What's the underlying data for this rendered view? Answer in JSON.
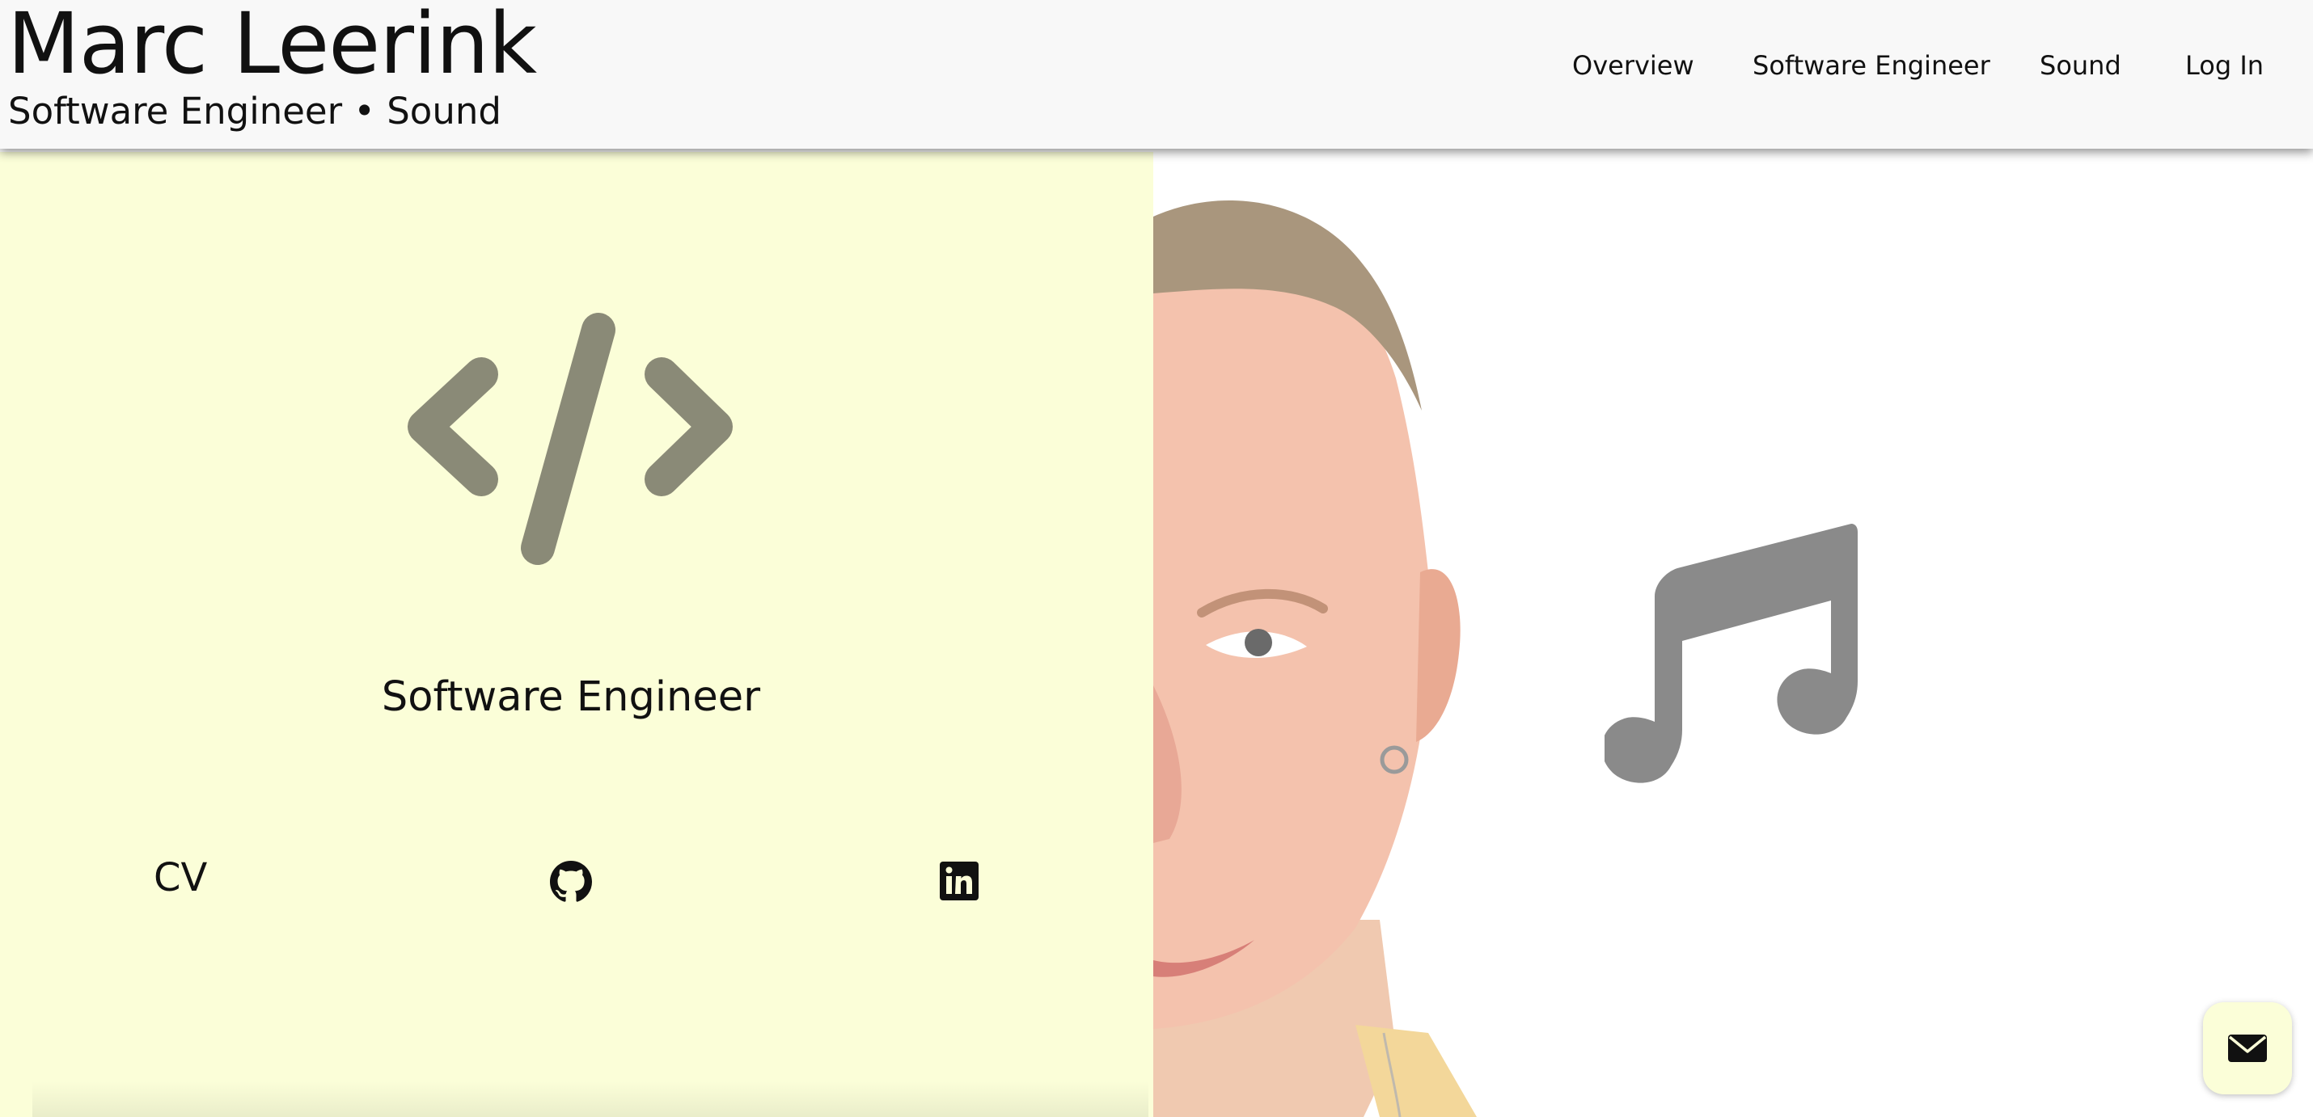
{
  "header": {
    "name": "Marc Leerink",
    "tagline": "Software Engineer • Sound"
  },
  "nav": {
    "items": [
      "Overview",
      "Software Engineer",
      "Sound",
      "Log In"
    ]
  },
  "left_panel": {
    "title": "Software Engineer",
    "icon": "code-icon",
    "links": {
      "cv_label": "CV",
      "github_icon": "github-icon",
      "linkedin_icon": "linkedin-icon"
    }
  },
  "right_panel": {
    "icon": "music-note-icon",
    "image": "portrait-photo"
  },
  "contact_button": {
    "icon": "mail-icon"
  },
  "colors": {
    "accent_bg": "#fbfed8",
    "icon_gray": "#8a8a77",
    "music_gray": "#8a8a8a",
    "header_bg": "#f8f8f8"
  }
}
